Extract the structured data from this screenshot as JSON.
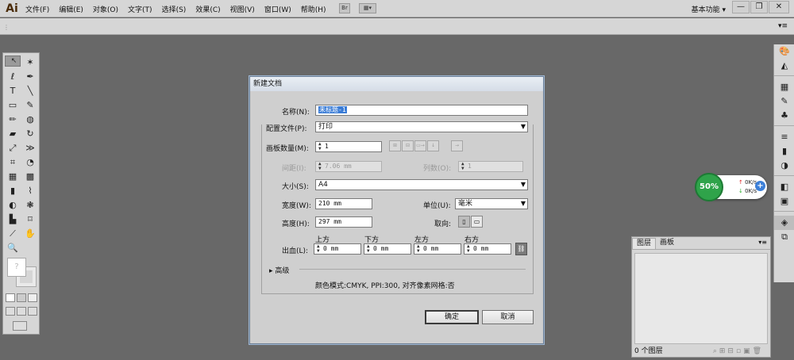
{
  "app": {
    "logo": "Ai",
    "menus": [
      "文件(F)",
      "编辑(E)",
      "对象(O)",
      "文字(T)",
      "选择(S)",
      "效果(C)",
      "视图(V)",
      "窗口(W)",
      "帮助(H)"
    ],
    "br_label": "Br",
    "workspace": "基本功能",
    "window_buttons": [
      "—",
      "❐",
      "✕"
    ]
  },
  "dialog": {
    "title": "新建文档",
    "name_label": "名称(N):",
    "name_value": "未标题-1",
    "profile_label": "配置文件(P):",
    "profile_value": "打印",
    "artboards_label": "画板数量(M):",
    "artboards_value": "1",
    "spacing_label": "间距(I):",
    "spacing_value": "7.06 mm",
    "columns_label": "列数(O):",
    "columns_value": "1",
    "size_label": "大小(S):",
    "size_value": "A4",
    "width_label": "宽度(W):",
    "width_value": "210 mm",
    "units_label": "单位(U):",
    "units_value": "毫米",
    "height_label": "高度(H):",
    "height_value": "297 mm",
    "orientation_label": "取向:",
    "bleed_label": "出血(L):",
    "bleed": [
      {
        "label": "上方",
        "value": "0 mm"
      },
      {
        "label": "下方",
        "value": "0 mm"
      },
      {
        "label": "左方",
        "value": "0 mm"
      },
      {
        "label": "右方",
        "value": "0 mm"
      }
    ],
    "advanced_label": "高级",
    "info": "颜色模式:CMYK, PPI:300, 对齐像素网格:否",
    "ok": "确定",
    "cancel": "取消"
  },
  "layers": {
    "tabs": [
      "图层",
      "画板"
    ],
    "count": "0 个图层"
  },
  "widget": {
    "percent": "50%",
    "up": "0K/s",
    "down": "0K/s"
  }
}
